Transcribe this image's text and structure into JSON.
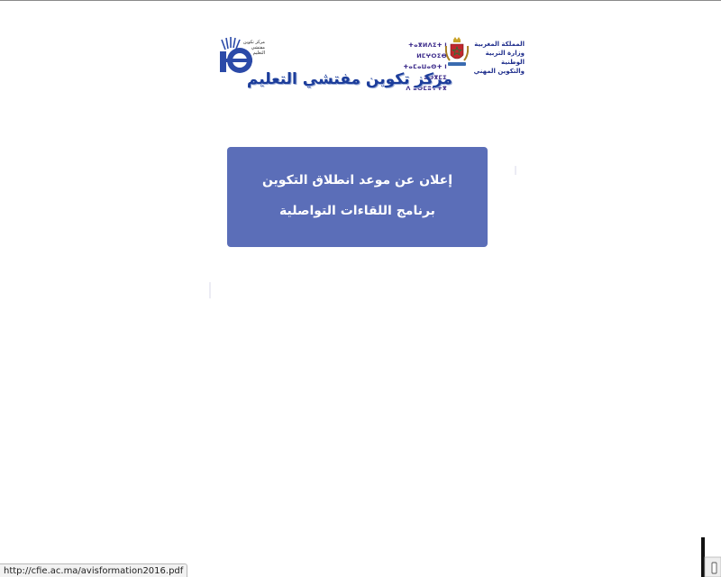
{
  "header": {
    "title": "مركز تكوين مفتشي التعليم",
    "logo_text": "مركز تكوين مفتشي التعليم",
    "ministry_lines": [
      "المملكة المغربية",
      "وزارة التربية الوطنية",
      "والتكوين المهني"
    ],
    "tifinagh_lines": [
      "ⵜⴰⴳⵍⴷⵉⵜ ⵏ ⵍⵎⵖⵔⵉⴱ",
      "ⵜⴰⵎⴰⵡⴰⵙⵜ ⵏ ⵓⵙⴳⵎⵉ",
      "ⴷ ⵓⵙⵎⵓⵜⵜⴳ"
    ]
  },
  "announcement": {
    "line1": "إعلان عن موعد انطلاق التكوين",
    "line2": "برنامج اللقاءات التواصلية"
  },
  "status": {
    "url": "http://cfie.ac.ma/avisformation2016.pdf"
  },
  "colors": {
    "announce_bg": "#5b6eb8",
    "title_blue": "#1c3d9b",
    "logo_blue": "#2b4aa8"
  }
}
